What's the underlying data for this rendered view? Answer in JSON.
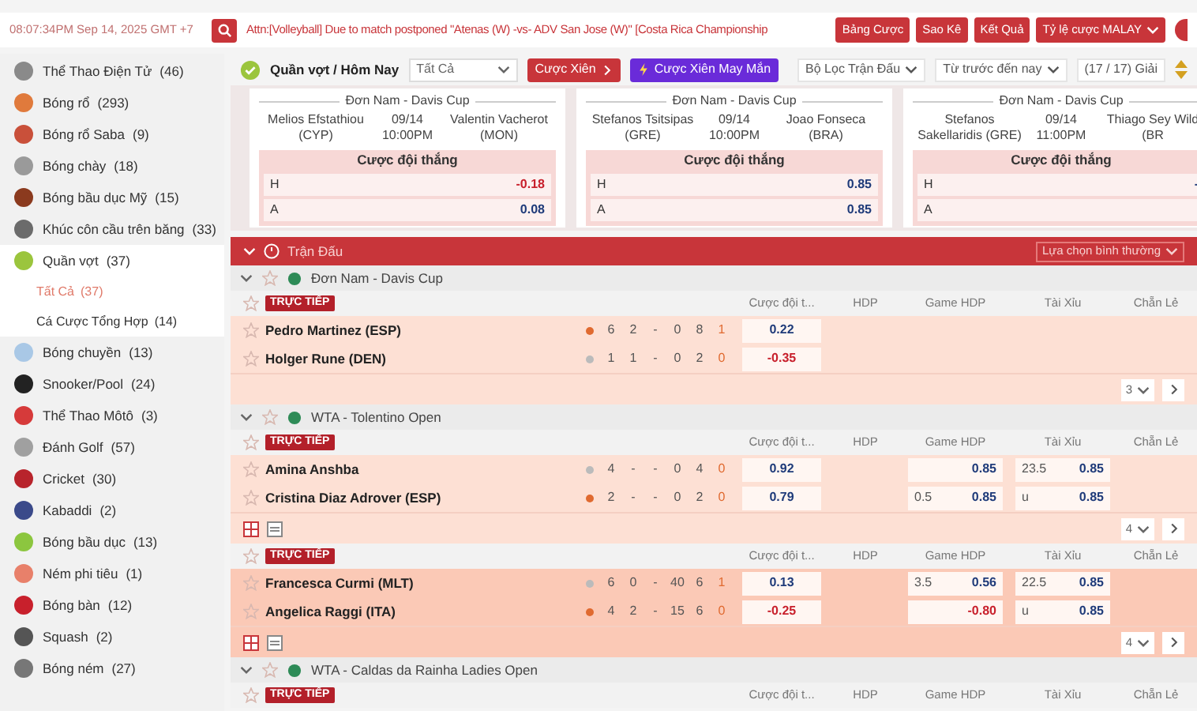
{
  "top_bar": {
    "time": "08:07:34PM Sep 14, 2025 GMT +7",
    "notice": "Attn:[Volleyball] Due to match postponed \"Atenas (W) -vs- ADV San Jose (W)\" [Costa Rica Championship",
    "buttons": [
      {
        "label": "Bảng Cược",
        "dropdown": false
      },
      {
        "label": "Sao Kê",
        "dropdown": false
      },
      {
        "label": "Kết Quả",
        "dropdown": false
      },
      {
        "label": "Tỷ lệ cược MALAY",
        "dropdown": true
      }
    ]
  },
  "sidebar": {
    "items": [
      {
        "label": "Thể Thao Điện Tử",
        "count": "(46)",
        "color": "#8a8a8a",
        "expanded": false
      },
      {
        "label": "Bóng rổ",
        "count": "(293)",
        "color": "#e07a3c",
        "expanded": false
      },
      {
        "label": "Bóng rổ Saba",
        "count": "(9)",
        "color": "#c9503a",
        "expanded": false
      },
      {
        "label": "Bóng chày",
        "count": "(18)",
        "color": "#9a9a9a",
        "expanded": false
      },
      {
        "label": "Bóng bầu dục Mỹ",
        "count": "(15)",
        "color": "#8b3a1e",
        "expanded": false
      },
      {
        "label": "Khúc côn cầu trên băng",
        "count": "(33)",
        "color": "#6b6b6b",
        "expanded": false
      },
      {
        "label": "Quần vợt",
        "count": "(37)",
        "color": "#9bc53d",
        "expanded": true,
        "children": [
          {
            "label": "Tất Cả",
            "count": "(37)",
            "selected": true
          },
          {
            "label": "Cá Cược Tổng Hợp",
            "count": "(14)",
            "selected": false
          }
        ]
      },
      {
        "label": "Bóng chuyền",
        "count": "(13)",
        "color": "#a9c8e6",
        "expanded": false
      },
      {
        "label": "Snooker/Pool",
        "count": "(24)",
        "color": "#222222",
        "expanded": false
      },
      {
        "label": "Thể Thao Môtô",
        "count": "(3)",
        "color": "#d63a3a",
        "expanded": false
      },
      {
        "label": "Đánh Golf",
        "count": "(57)",
        "color": "#a0a0a0",
        "expanded": false
      },
      {
        "label": "Cricket",
        "count": "(30)",
        "color": "#b8242c",
        "expanded": false
      },
      {
        "label": "Kabaddi",
        "count": "(2)",
        "color": "#3b4a8a",
        "expanded": false
      },
      {
        "label": "Bóng bầu dục",
        "count": "(13)",
        "color": "#8cc63f",
        "expanded": false
      },
      {
        "label": "Ném phi tiêu",
        "count": "(1)",
        "color": "#e8806a",
        "expanded": false
      },
      {
        "label": "Bóng bàn",
        "count": "(12)",
        "color": "#c8202c",
        "expanded": false
      },
      {
        "label": "Squash",
        "count": "(2)",
        "color": "#555555",
        "expanded": false
      },
      {
        "label": "Bóng ném",
        "count": "(27)",
        "color": "#777777",
        "expanded": false
      }
    ]
  },
  "toolbar": {
    "title": "Quần vợt / Hôm Nay",
    "select": "Tất Cả",
    "parlay": "Cược Xiên",
    "lucky": "Cược Xiên May Mắn",
    "filters": [
      "Bộ Lọc Trận Đấu",
      "Từ trước đến nay"
    ],
    "leagues": "(17 / 17) Giải"
  },
  "cards": [
    {
      "league": "Đơn Nam - Davis Cup",
      "home": "Melios Efstathiou (CYP)",
      "date": "09/14",
      "time": "10:00PM",
      "away": "Valentin Vacherot (MON)",
      "market": "Cược đội thắng",
      "rows": [
        {
          "side": "H",
          "value": "-0.18",
          "negative": true
        },
        {
          "side": "A",
          "value": "0.08",
          "negative": false
        }
      ]
    },
    {
      "league": "Đơn Nam - Davis Cup",
      "home": "Stefanos Tsitsipas (GRE)",
      "date": "09/14",
      "time": "10:00PM",
      "away": "Joao Fonseca (BRA)",
      "market": "Cược đội thắng",
      "rows": [
        {
          "side": "H",
          "value": "0.85",
          "negative": false
        },
        {
          "side": "A",
          "value": "0.85",
          "negative": false
        }
      ]
    },
    {
      "league": "Đơn Nam - Davis Cup",
      "home": "Stefanos Sakellaridis (GRE)",
      "date": "09/14",
      "time": "11:00PM",
      "away": "Thiago Sey Wild (BR",
      "market": "Cược đội thắng",
      "rows": [
        {
          "side": "H",
          "value": "-",
          "negative": false
        },
        {
          "side": "A"
        }
      ]
    }
  ],
  "section": {
    "title": "Trận Đấu",
    "option": "Lựa chọn bình thường"
  },
  "leagues": [
    {
      "name": "Đơn Nam - Davis Cup",
      "expanded": true,
      "matches": [
        {
          "badge": "TRỰC TIẾP",
          "highlighted": false,
          "tools": false,
          "more": "3",
          "columns": [
            "Cược đội t...",
            "HDP",
            "Game HDP",
            "Tài Xỉu",
            "Chẵn Lẻ"
          ],
          "players": [
            {
              "name": "Pedro Martinez (ESP)",
              "serving": true,
              "scores": [
                "6",
                "2",
                "-",
                "0",
                "8",
                "1"
              ],
              "win": {
                "value": "0.22",
                "negative": false
              }
            },
            {
              "name": "Holger Rune (DEN)",
              "serving": false,
              "scores": [
                "1",
                "1",
                "-",
                "0",
                "2",
                "0"
              ],
              "win": {
                "value": "-0.35",
                "negative": true
              }
            }
          ]
        }
      ]
    },
    {
      "name": "WTA - Tolentino Open",
      "expanded": true,
      "matches": [
        {
          "badge": "TRỰC TIẾP",
          "highlighted": false,
          "tools": true,
          "more": "4",
          "columns": [
            "Cược đội t...",
            "HDP",
            "Game HDP",
            "Tài Xỉu",
            "Chẵn Lẻ"
          ],
          "players": [
            {
              "name": "Amina Anshba",
              "serving": false,
              "scores": [
                "4",
                "-",
                "-",
                "0",
                "4",
                "0"
              ],
              "win": {
                "value": "0.92",
                "negative": false
              },
              "game_hdp": {
                "odds": "0.85",
                "negative": false
              },
              "total": {
                "line": "23.5",
                "odds": "0.85",
                "negative": false
              }
            },
            {
              "name": "Cristina Diaz Adrover (ESP)",
              "serving": true,
              "scores": [
                "2",
                "-",
                "-",
                "0",
                "2",
                "0"
              ],
              "win": {
                "value": "0.79",
                "negative": false
              },
              "game_hdp": {
                "line": "0.5",
                "odds": "0.85",
                "negative": false
              },
              "total": {
                "line": "u",
                "odds": "0.85",
                "negative": false
              }
            }
          ]
        },
        {
          "badge": "TRỰC TIẾP",
          "highlighted": true,
          "tools": true,
          "more": "4",
          "columns": [
            "Cược đội t...",
            "HDP",
            "Game HDP",
            "Tài Xỉu",
            "Chẵn Lẻ"
          ],
          "players": [
            {
              "name": "Francesca Curmi (MLT)",
              "serving": false,
              "scores": [
                "6",
                "0",
                "-",
                "40",
                "6",
                "1"
              ],
              "win": {
                "value": "0.13",
                "negative": false
              },
              "game_hdp": {
                "line": "3.5",
                "odds": "0.56",
                "negative": false
              },
              "total": {
                "line": "22.5",
                "odds": "0.85",
                "negative": false
              }
            },
            {
              "name": "Angelica Raggi (ITA)",
              "serving": true,
              "scores": [
                "4",
                "2",
                "-",
                "15",
                "6",
                "0"
              ],
              "win": {
                "value": "-0.25",
                "negative": true
              },
              "game_hdp": {
                "odds": "-0.80",
                "negative": true
              },
              "total": {
                "line": "u",
                "odds": "0.85",
                "negative": false
              }
            }
          ]
        }
      ]
    },
    {
      "name": "WTA - Caldas da Rainha Ladies Open",
      "expanded": true,
      "matches": [
        {
          "badge": "TRỰC TIẾP",
          "highlighted": false,
          "columns": [
            "Cược đội t...",
            "HDP",
            "Game HDP",
            "Tài Xỉu",
            "Chẵn Lẻ"
          ]
        }
      ]
    }
  ]
}
